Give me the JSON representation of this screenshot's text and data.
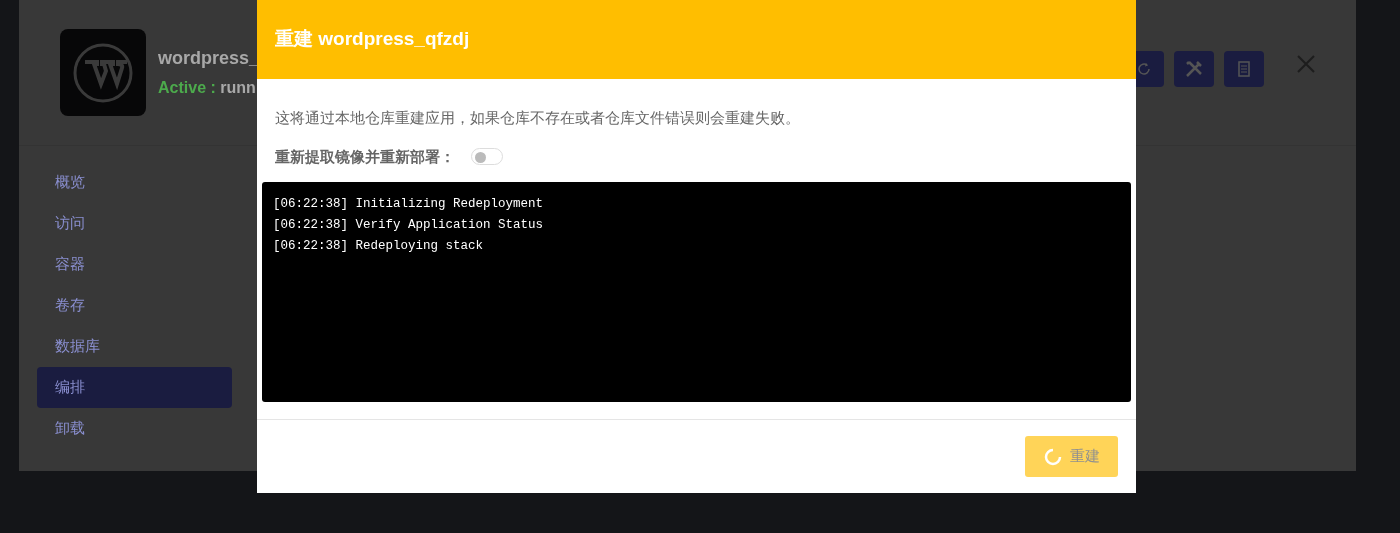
{
  "app": {
    "name": "wordpress_",
    "status_label": "Active :",
    "status_value": "runn",
    "header_buttons": [
      {
        "kind": "refresh"
      },
      {
        "kind": "tools"
      },
      {
        "kind": "document"
      }
    ],
    "sidebar": {
      "items": [
        {
          "label": "概览",
          "selected": false
        },
        {
          "label": "访问",
          "selected": false
        },
        {
          "label": "容器",
          "selected": false
        },
        {
          "label": "卷存",
          "selected": false
        },
        {
          "label": "数据库",
          "selected": false
        },
        {
          "label": "编排",
          "selected": true
        },
        {
          "label": "卸载",
          "selected": false
        }
      ]
    }
  },
  "modal": {
    "title": "重建 wordpress_qfzdj",
    "description": "这将通过本地仓库重建应用，如果仓库不存在或者仓库文件错误则会重建失败。",
    "toggle": {
      "label": "重新提取镜像并重新部署：",
      "on": false
    },
    "log": [
      "[06:22:38] Initializing Redeployment",
      "[06:22:38] Verify Application Status",
      "[06:22:38] Redeploying stack"
    ],
    "submit": {
      "label": "重建",
      "loading": true,
      "disabled": true
    }
  }
}
